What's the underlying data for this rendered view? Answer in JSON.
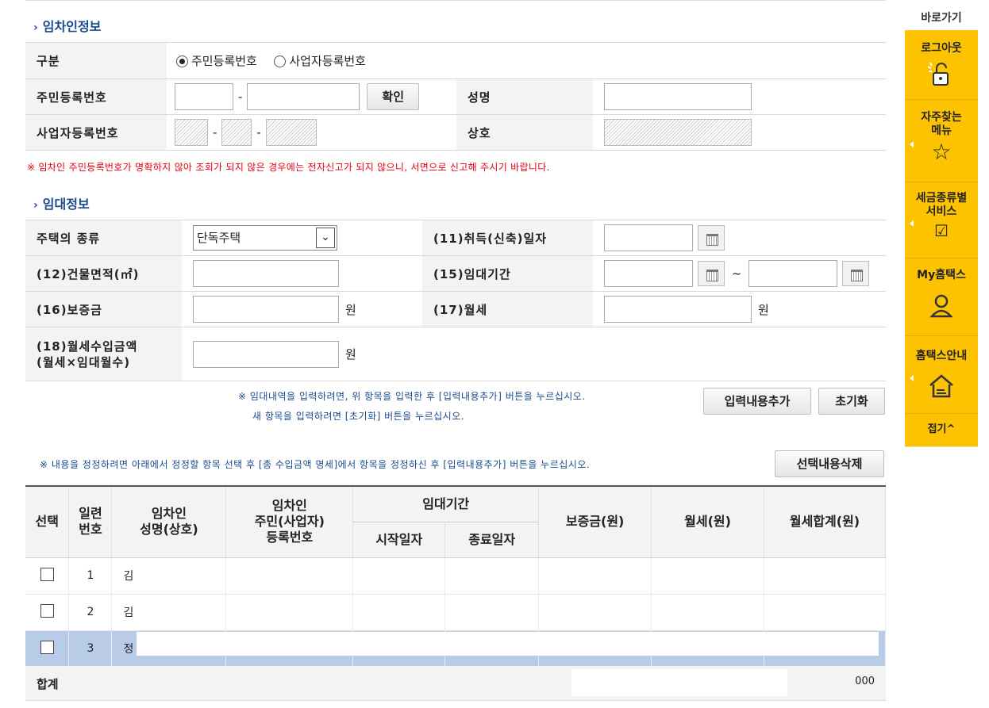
{
  "section1": {
    "title": "임차인정보",
    "rows": {
      "type_label": "구분",
      "radio_resident": "주민등록번호",
      "radio_business": "사업자등록번호",
      "rrn_label": "주민등록번호",
      "confirm_button": "확인",
      "name_label": "성명",
      "brn_label": "사업자등록번호",
      "company_label": "상호"
    },
    "warning": "※ 임차인 주민등록번호가 명확하지 않아 조회가 되지 않은 경우에는 전자신고가 되지 않으니, 서면으로 신고해 주시기 바랍니다."
  },
  "section2": {
    "title": "임대정보",
    "house_type_label": "주택의 종류",
    "house_type_value": "단독주택",
    "acquire_date_label": "(11)취득(신축)일자",
    "area_label": "(12)건물면적(㎡)",
    "lease_period_label": "(15)임대기간",
    "tilde": "~",
    "deposit_label": "(16)보증금",
    "monthly_label": "(17)월세",
    "won": "원",
    "income_label_1": "(18)월세수입금액",
    "income_label_2": "(월세×임대월수)",
    "note_1": "※ 임대내역을 입력하려면, 위 항목을 입력한 후 [입력내용추가] 버튼을 누르십시오.",
    "note_2": "새 항목을 입력하려면 [초기화] 버튼을 누르십시오.",
    "add_button": "입력내용추가",
    "reset_button": "초기화"
  },
  "list": {
    "note": "※ 내용을 정정하려면 아래에서 정정할 항목 선택 후 [총 수입금액 명세]에서 항목을 정정하신 후 [입력내용추가] 버튼을 누르십시오.",
    "delete_button": "선택내용삭제",
    "headers": {
      "select": "선택",
      "seq_1": "일련",
      "seq_2": "번호",
      "name_1": "임차인",
      "name_2": "성명(상호)",
      "id_1": "임차인",
      "id_2": "주민(사업자)",
      "id_3": "등록번호",
      "period": "임대기간",
      "start": "시작일자",
      "end": "종료일자",
      "deposit": "보증금(원)",
      "monthly": "월세(원)",
      "monthly_total": "월세합계(원)"
    },
    "rows": [
      {
        "no": "1",
        "name": "김"
      },
      {
        "no": "2",
        "name": "김"
      },
      {
        "no": "3",
        "name": "정"
      }
    ],
    "total_label": "합계",
    "total_value": "000"
  },
  "quick": {
    "title": "바로가기",
    "logout": "로그아웃",
    "faq_1": "자주찾는",
    "faq_2": "메뉴",
    "tax_1": "세금종류별",
    "tax_2": "서비스",
    "myhometax": "My홈택스",
    "guide": "홈택스안내",
    "fold": "접기^"
  },
  "colors": {
    "accent": "#1a4b8f",
    "warning": "#e60012",
    "quick_bg": "#fdc300",
    "selected_row": "#b8cce8"
  }
}
